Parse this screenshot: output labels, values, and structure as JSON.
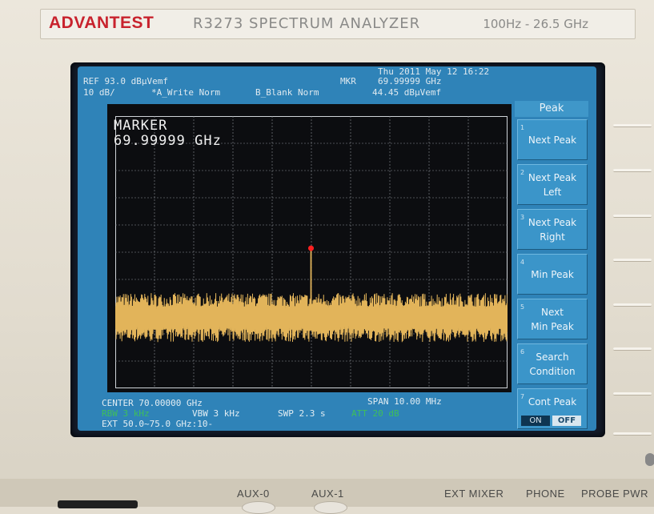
{
  "brand": "ADVANTEST",
  "model": "R3273  SPECTRUM  ANALYZER",
  "freq_range": "100Hz - 26.5 GHz",
  "screen": {
    "datetime": "Thu 2011 May 12 16:22",
    "ref_level": "REF 93.0 dBµVemf",
    "scale": "10 dB/",
    "trace_a": "*A_Write Norm",
    "trace_b": "B_Blank Norm",
    "mkr_label": "MKR",
    "mkr_freq": "69.99999 GHz",
    "mkr_level": "44.45 dBµVemf",
    "marker_title": "MARKER",
    "marker_freq": "69.99999 GHz",
    "center": "CENTER 70.00000 GHz",
    "span": "SPAN 10.00 MHz",
    "rbw": "RBW 3 kHz",
    "vbw": "VBW 3 kHz",
    "swp": "SWP 2.3 s",
    "att": "ATT 20 dB",
    "ext": "EXT 50.0~75.0 GHz:10-"
  },
  "softkeys": {
    "title": "Peak",
    "items": [
      {
        "num": "1",
        "label": "Next Peak"
      },
      {
        "num": "2",
        "label": "Next Peak\nLeft"
      },
      {
        "num": "3",
        "label": "Next Peak\nRight"
      },
      {
        "num": "4",
        "label": "Min Peak"
      },
      {
        "num": "5",
        "label": "Next\nMin Peak"
      },
      {
        "num": "6",
        "label": "Search\nCondition"
      },
      {
        "num": "7",
        "label": "Cont Peak"
      }
    ],
    "on_label": "ON",
    "off_label": "OFF"
  },
  "panel": {
    "aux0": "AUX-0",
    "aux1": "AUX-1",
    "ext_mixer": "EXT MIXER",
    "phone": "PHONE",
    "probe_pwr": "PROBE PWR"
  },
  "colors": {
    "trace": "#e2b45a",
    "marker": "#ff2020",
    "screen_bg": "#2f83b8",
    "brand_red": "#c8222d"
  },
  "chart_data": {
    "type": "line",
    "title": "",
    "xlabel": "",
    "ylabel": "",
    "x_center_ghz": 70.0,
    "span_mhz": 10.0,
    "x_range_ghz": [
      69.995,
      70.005
    ],
    "ref_level_dbuvemf": 93.0,
    "scale_db_per_div": 10,
    "ylim": [
      -7,
      93
    ],
    "noise_floor_dbuvemf": 19,
    "series": [
      {
        "x": [
          69.995,
          69.99999,
          70.005
        ],
        "values": [
          19,
          44.45,
          19
        ]
      }
    ],
    "marker": {
      "x": 69.99999,
      "y": 44.45
    },
    "grid": true
  }
}
